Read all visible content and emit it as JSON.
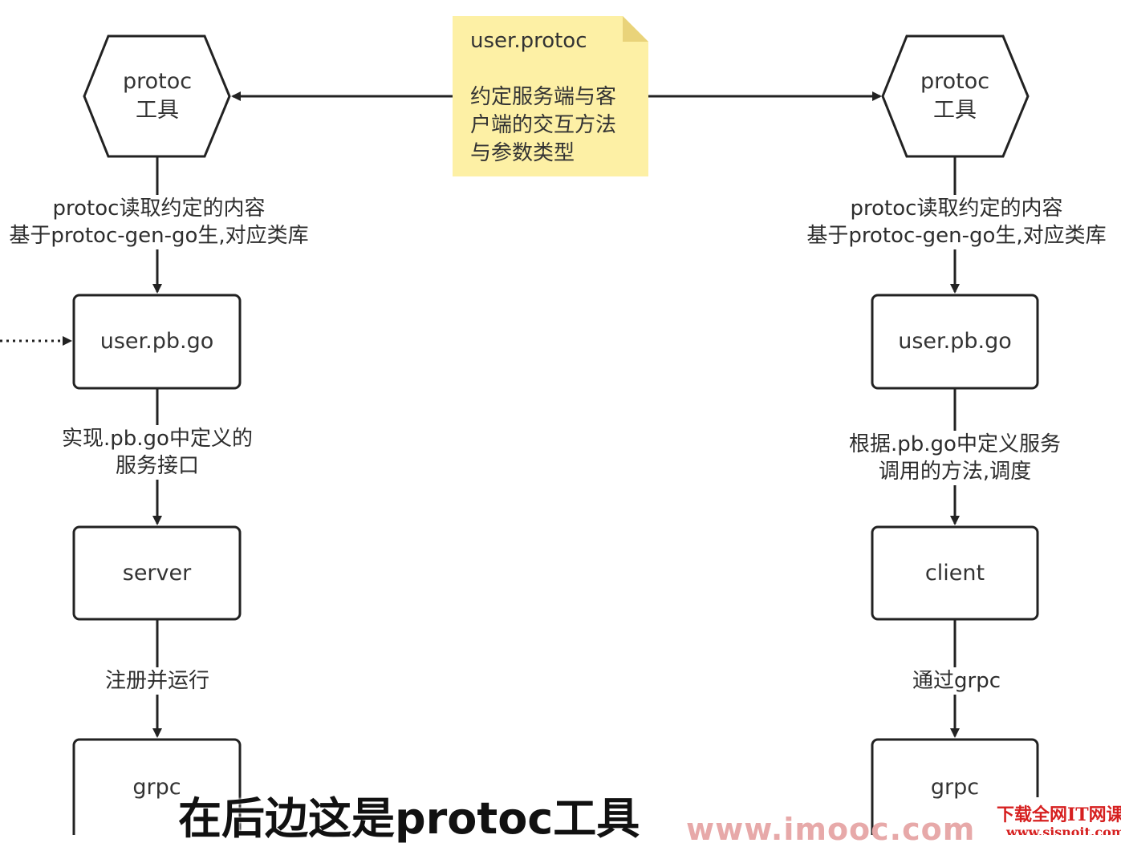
{
  "note": {
    "title": "user.protoc",
    "body": "约定服务端与客\n户端的交互方法\n与参数类型",
    "color": "#fdf0a5"
  },
  "left": {
    "tool": "protoc\n工具",
    "step1": "protoc读取约定的内容\n基于protoc-gen-go生,对应类库",
    "pb": "user.pb.go",
    "step2": "实现.pb.go中定义的\n服务接口",
    "node": "server",
    "step3": "注册并运行",
    "grpc": "grpc"
  },
  "right": {
    "tool": "protoc\n工具",
    "step1": "protoc读取约定的内容\n基于protoc-gen-go生,对应类库",
    "pb": "user.pb.go",
    "step2": "根据.pb.go中定义服务\n调用的方法,调度",
    "node": "client",
    "step3": "通过grpc",
    "grpc": "grpc"
  },
  "overlay": {
    "subtitle": "在后边这是protoc工具",
    "watermark": "www.imooc.com",
    "site_line1": "下载全网IT网课",
    "site_line2": "www.sjsnoit.com"
  }
}
